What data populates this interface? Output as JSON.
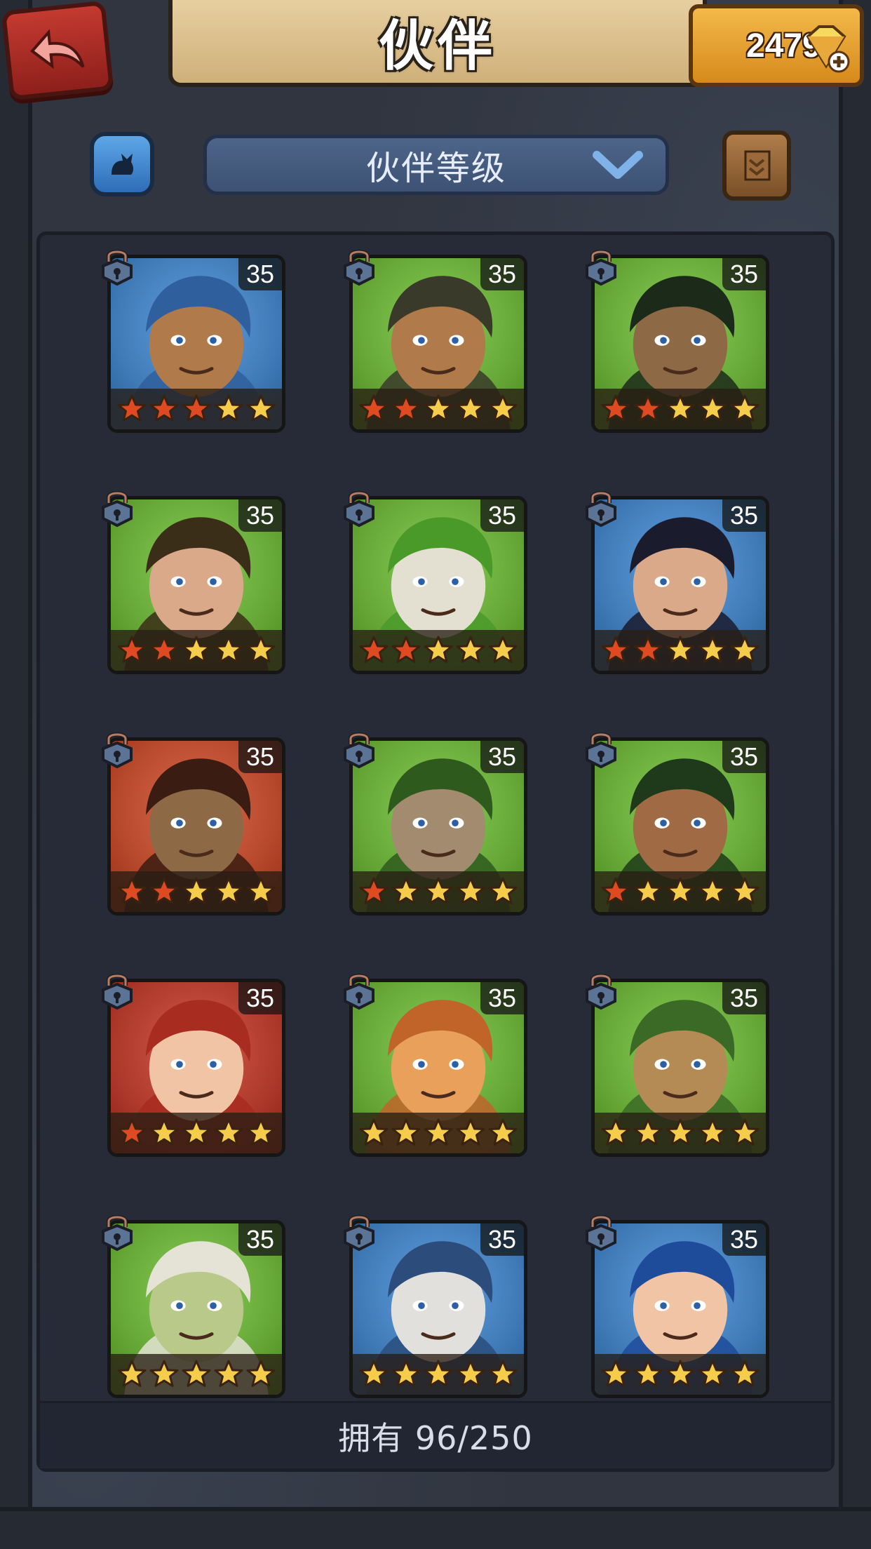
{
  "header": {
    "title": "伙伴",
    "gems": "2479"
  },
  "filter": {
    "sort_label": "伙伴等级"
  },
  "companions": [
    {
      "level": "35",
      "stars_red": 3,
      "bg": "#3a86d4",
      "skin": "#b07a4a",
      "hair": "#2f5f9c"
    },
    {
      "level": "35",
      "stars_red": 2,
      "bg": "#6bbf2e",
      "skin": "#b07a4a",
      "hair": "#3a3a2a"
    },
    {
      "level": "35",
      "stars_red": 2,
      "bg": "#6bbf2e",
      "skin": "#8d6a45",
      "hair": "#1c2a1a"
    },
    {
      "level": "35",
      "stars_red": 2,
      "bg": "#6bbf2e",
      "skin": "#d9a98a",
      "hair": "#3b2e18"
    },
    {
      "level": "35",
      "stars_red": 2,
      "bg": "#6bbf2e",
      "skin": "#e3e0d2",
      "hair": "#4a9a2a"
    },
    {
      "level": "35",
      "stars_red": 2,
      "bg": "#3a86d4",
      "skin": "#d9a98a",
      "hair": "#1b1b2e"
    },
    {
      "level": "35",
      "stars_red": 2,
      "bg": "#d2441f",
      "skin": "#8d6a45",
      "hair": "#3a1c12"
    },
    {
      "level": "35",
      "stars_red": 1,
      "bg": "#6bbf2e",
      "skin": "#a38b70",
      "hair": "#2f5a1e"
    },
    {
      "level": "35",
      "stars_red": 1,
      "bg": "#6bbf2e",
      "skin": "#a06a45",
      "hair": "#1e3a1a"
    },
    {
      "level": "35",
      "stars_red": 1,
      "bg": "#c7321f",
      "skin": "#f0c4a4",
      "hair": "#a82c20"
    },
    {
      "level": "35",
      "stars_red": 0,
      "bg": "#6bbf2e",
      "skin": "#e9a05a",
      "hair": "#c0642a"
    },
    {
      "level": "35",
      "stars_red": 0,
      "bg": "#6bbf2e",
      "skin": "#b58b55",
      "hair": "#3b6a26"
    },
    {
      "level": "35",
      "stars_red": 0,
      "bg": "#6bbf2e",
      "skin": "#b9c98a",
      "hair": "#e5e3d5"
    },
    {
      "level": "35",
      "stars_red": 0,
      "bg": "#3a86d4",
      "skin": "#e2e0dc",
      "hair": "#2c4d7c"
    },
    {
      "level": "35",
      "stars_red": 0,
      "bg": "#3a86d4",
      "skin": "#f0c4a4",
      "hair": "#1f4c9a"
    }
  ],
  "footer": {
    "owned_label": "拥有 96/250"
  },
  "colors": {
    "star_red": "#e04a22",
    "star_gold": "#f6cd4a",
    "accent_blue": "#4d6589"
  }
}
